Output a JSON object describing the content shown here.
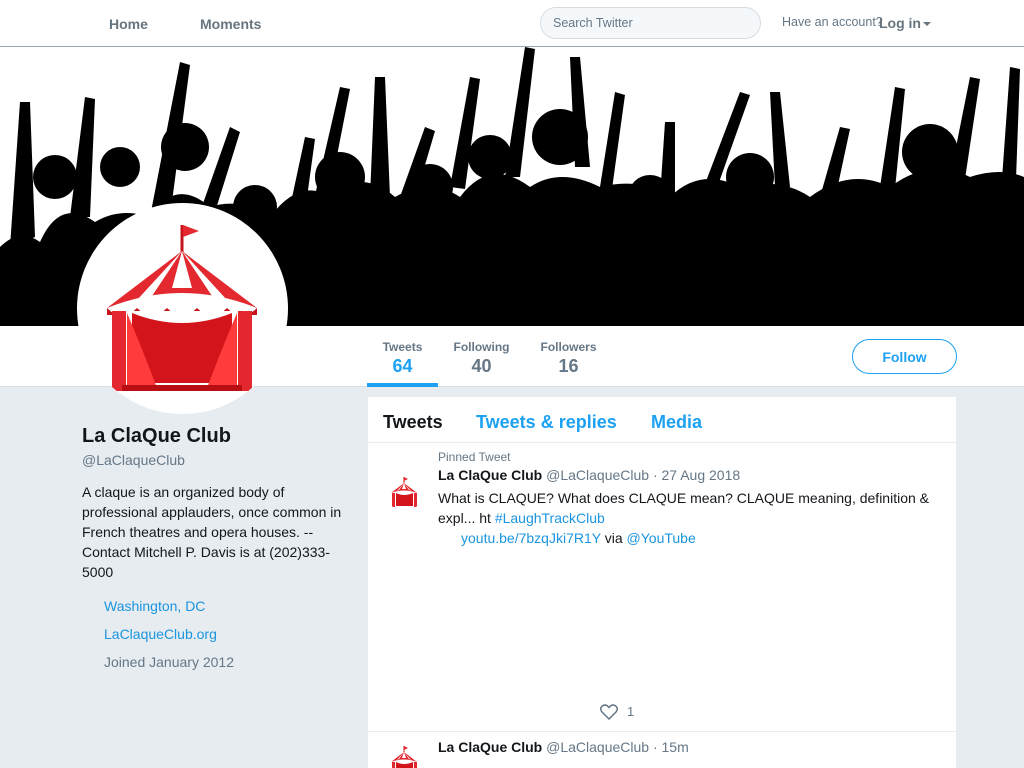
{
  "nav": {
    "home": "Home",
    "moments": "Moments",
    "search_placeholder": "Search Twitter",
    "have_account": "Have an account?",
    "login": "Log in"
  },
  "profile": {
    "name": "La ClaQue Club",
    "handle": "@LaClaqueClub",
    "bio": "A claque is an organized body of professional applauders, once common in French theatres and opera houses. -- Contact Mitchell P. Davis is at (202)333-5000",
    "location": "Washington, DC",
    "website": "LaClaqueClub.org",
    "joined": "Joined January 2012"
  },
  "stats": {
    "tweets_label": "Tweets",
    "tweets": "64",
    "following_label": "Following",
    "following": "40",
    "followers_label": "Followers",
    "followers": "16"
  },
  "follow_label": "Follow",
  "tabs": {
    "tweets": "Tweets",
    "replies": "Tweets & replies",
    "media": "Media"
  },
  "tweets": [
    {
      "pinned": "Pinned Tweet",
      "name": "La ClaQue Club",
      "handle": "@LaClaqueClub",
      "date": "· 27 Aug 2018",
      "text_a": "What is CLAQUE? What does CLAQUE mean? CLAQUE meaning, definition & expl... ht ",
      "hashtag": "#LaughTrackClub",
      "link": "youtu.be/7bzqJki7R1Y",
      "via": " via ",
      "mention": "@YouTube",
      "likes": "1"
    },
    {
      "name": "La ClaQue Club",
      "handle": "@LaClaqueClub",
      "date": "· 15m"
    }
  ]
}
